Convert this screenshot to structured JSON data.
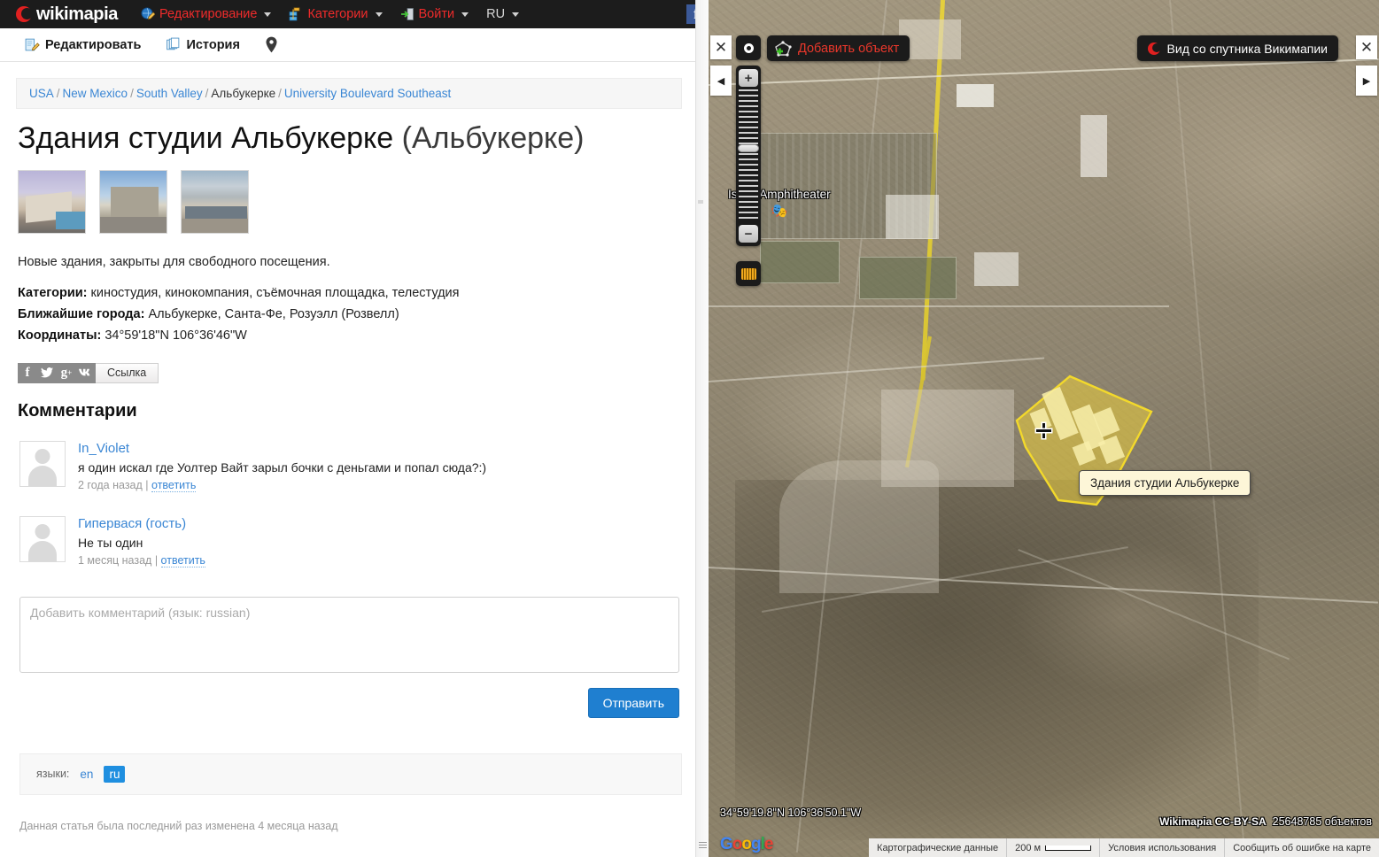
{
  "topnav": {
    "brand": "wikimapia",
    "items": [
      {
        "label": "Редактирование",
        "icon": "edit-globe-icon",
        "caret": true
      },
      {
        "label": "Категории",
        "icon": "categories-icon",
        "caret": true
      },
      {
        "label": "Войти",
        "icon": "login-door-icon",
        "caret": true
      },
      {
        "label": "RU",
        "icon": "",
        "caret": true
      }
    ],
    "facebook_label": "f"
  },
  "subbar": {
    "edit_label": "Редактировать",
    "edit_icon": "pencil-page-icon",
    "history_label": "История",
    "history_icon": "pages-icon",
    "pin_icon": "map-pin-icon"
  },
  "breadcrumb": {
    "items": [
      "USA",
      "New Mexico",
      "South Valley",
      "Альбукерке",
      "University Boulevard Southeast"
    ],
    "separator": "/"
  },
  "article": {
    "title_main": "Здания студии Альбукерке",
    "title_paren": "(Альбукерке)",
    "description": "Новые здания, закрыты для свободного посещения.",
    "thumbnails": [
      {
        "name": "studio-building-photo-1"
      },
      {
        "name": "studio-building-photo-2"
      },
      {
        "name": "studio-building-photo-3"
      }
    ],
    "meta": [
      {
        "label": "Категории:",
        "value": "киностудия,  кинокомпания,   съёмочная площадка,   телестудия"
      },
      {
        "label": "Ближайшие города:",
        "value": "Альбукерке,   Санта-Фе,   Розуэлл (Розвелл)"
      },
      {
        "label": "Координаты:",
        "value": "34°59'18\"N 106°36'46\"W"
      }
    ]
  },
  "share": {
    "buttons": [
      {
        "icon": "facebook-icon",
        "glyph": "f"
      },
      {
        "icon": "twitter-icon",
        "glyph": "✐"
      },
      {
        "icon": "googleplus-icon",
        "glyph": "g"
      },
      {
        "icon": "vk-icon",
        "glyph": "VK"
      }
    ],
    "link_label": "Ссылка"
  },
  "comments": {
    "heading": "Комментарии",
    "list": [
      {
        "author": "In_Violet",
        "text": "я один искал где Уолтер Вайт зарыл бочки с деньгами и попал сюда?:)",
        "time": "2 года назад",
        "reply_label": "ответить"
      },
      {
        "author": "Гипервася (гость)",
        "text": "Не ты один",
        "time": "1 месяц назад",
        "reply_label": "ответить"
      }
    ],
    "form": {
      "placeholder": "Добавить комментарий (язык: russian)",
      "value": "",
      "submit_label": "Отправить"
    }
  },
  "languages": {
    "label": "языки:",
    "items": [
      {
        "code": "en",
        "active": false
      },
      {
        "code": "ru",
        "active": true
      }
    ]
  },
  "footnote": "Данная статья была последний раз изменена 4 месяца назад",
  "map": {
    "close_left_icon": "close-icon",
    "collapse_left_icon": "chevron-left-icon",
    "close_right_icon": "close-icon",
    "expand_right_icon": "chevron-right-icon",
    "locate_icon": "locate-target-icon",
    "add_object": {
      "label": "Добавить объект",
      "icon": "add-polygon-icon"
    },
    "satellite_view": {
      "label": "Вид со спутника Викимапии",
      "icon": "wikimapia-moon-icon"
    },
    "zoom": {
      "in_label": "+",
      "out_label": "−",
      "in_icon": "plus-icon",
      "out_icon": "minus-icon"
    },
    "ruler_icon": "ruler-icon",
    "poi_label": "Isleta Amphitheater",
    "poi_icon": "theater-masks-icon",
    "selected_object_tooltip": "Здания студии Альбукерке",
    "cursor_icon": "crosshair-cursor-icon",
    "coordinates": "34°59'19.8\"N 106°36'50.1\"W",
    "google_logo": "Google",
    "attribution": "Wikimapia CC-BY-SA",
    "object_count": "25648785 объектов",
    "footer": {
      "map_data": "Картографические данные",
      "scale": "200 м",
      "terms": "Условия использования",
      "report": "Сообщить об ошибке на карте"
    }
  },
  "colors": {
    "brand_red": "#e02020",
    "nav_red": "#ef2b2b",
    "link_blue": "#3a86d4",
    "submit_blue": "#1f7fd0",
    "active_lang": "#1f8fe0",
    "polygon_yellow": "#e8d23a",
    "tooltip_bg": "#fdf6d8"
  }
}
